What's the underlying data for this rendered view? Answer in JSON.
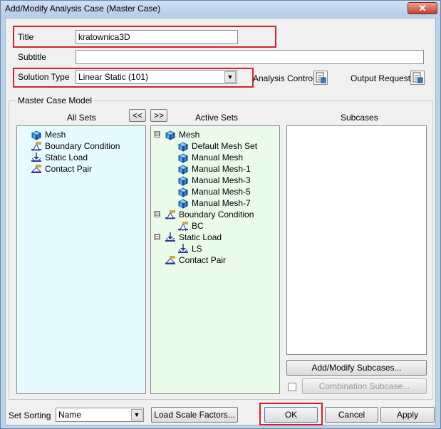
{
  "window": {
    "title": "Add/Modify Analysis Case (Master Case)",
    "close": "✕"
  },
  "form": {
    "title_label": "Title",
    "title_value": "kratownica3D",
    "subtitle_label": "Subtitle",
    "subtitle_value": "",
    "solution_type_label": "Solution Type",
    "solution_type_value": "Linear Static (101)",
    "analysis_control_label": "Analysis Control",
    "output_request_label": "Output Request"
  },
  "master_case": {
    "group_label": "Master Case Model",
    "all_sets_label": "All Sets",
    "active_sets_label": "Active Sets",
    "subcases_label": "Subcases",
    "move_left": "<<",
    "move_right": ">>",
    "all_sets": [
      {
        "label": "Mesh",
        "icon": "mesh-icon"
      },
      {
        "label": "Boundary Condition",
        "icon": "boundary-condition-icon"
      },
      {
        "label": "Static Load",
        "icon": "static-load-icon"
      },
      {
        "label": "Contact Pair",
        "icon": "contact-pair-icon"
      }
    ],
    "active_sets": [
      {
        "label": "Mesh",
        "icon": "mesh-icon"
      },
      {
        "label": "Default Mesh Set",
        "icon": "mesh-icon"
      },
      {
        "label": "Manual Mesh",
        "icon": "mesh-icon"
      },
      {
        "label": "Manual Mesh-1",
        "icon": "mesh-icon"
      },
      {
        "label": "Manual Mesh-3",
        "icon": "mesh-icon"
      },
      {
        "label": "Manual Mesh-5",
        "icon": "mesh-icon"
      },
      {
        "label": "Manual Mesh-7",
        "icon": "mesh-icon"
      },
      {
        "label": "Boundary Condition",
        "icon": "boundary-condition-icon"
      },
      {
        "label": "BC",
        "icon": "boundary-condition-icon"
      },
      {
        "label": "Static Load",
        "icon": "static-load-icon"
      },
      {
        "label": "LS",
        "icon": "static-load-icon"
      },
      {
        "label": "Contact Pair",
        "icon": "contact-pair-icon"
      }
    ],
    "expanders": [
      "⊟",
      "⊟",
      "⊟"
    ],
    "add_modify_subcases": "Add/Modify Subcases...",
    "combination_subcase": "Combination Subcase..."
  },
  "footer": {
    "set_sorting_label": "Set Sorting",
    "set_sorting_value": "Name",
    "load_scale_factors": "Load Scale Factors...",
    "ok": "OK",
    "cancel": "Cancel",
    "apply": "Apply"
  },
  "colors": {
    "all_sets_bg": "#e6fbff",
    "active_sets_bg": "#ebfbe9",
    "highlight_red": "#d2232a"
  }
}
